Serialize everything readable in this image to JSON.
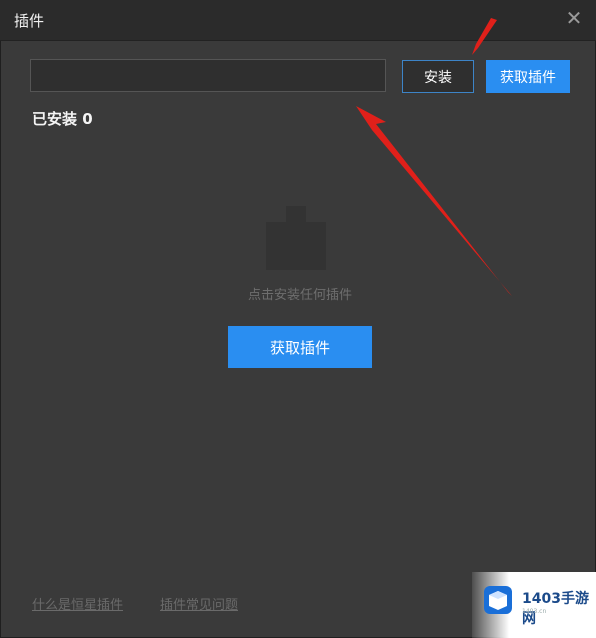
{
  "window": {
    "title": "插件"
  },
  "toolbar": {
    "input_value": "",
    "install_label": "安装",
    "get_plugins_label": "获取插件"
  },
  "installed": {
    "label": "已安装 0"
  },
  "empty_state": {
    "message": "点击安装任何插件",
    "button_label": "获取插件"
  },
  "footer": {
    "link1": "什么是恒星插件",
    "link2": "插件常见问题"
  },
  "watermark": {
    "brand": "1403手游网",
    "url": "1403.cn"
  },
  "colors": {
    "background": "#3a3a3a",
    "titlebar": "#2b2b2b",
    "accent": "#2a8ef1",
    "annotation_arrow": "#e0201a"
  }
}
